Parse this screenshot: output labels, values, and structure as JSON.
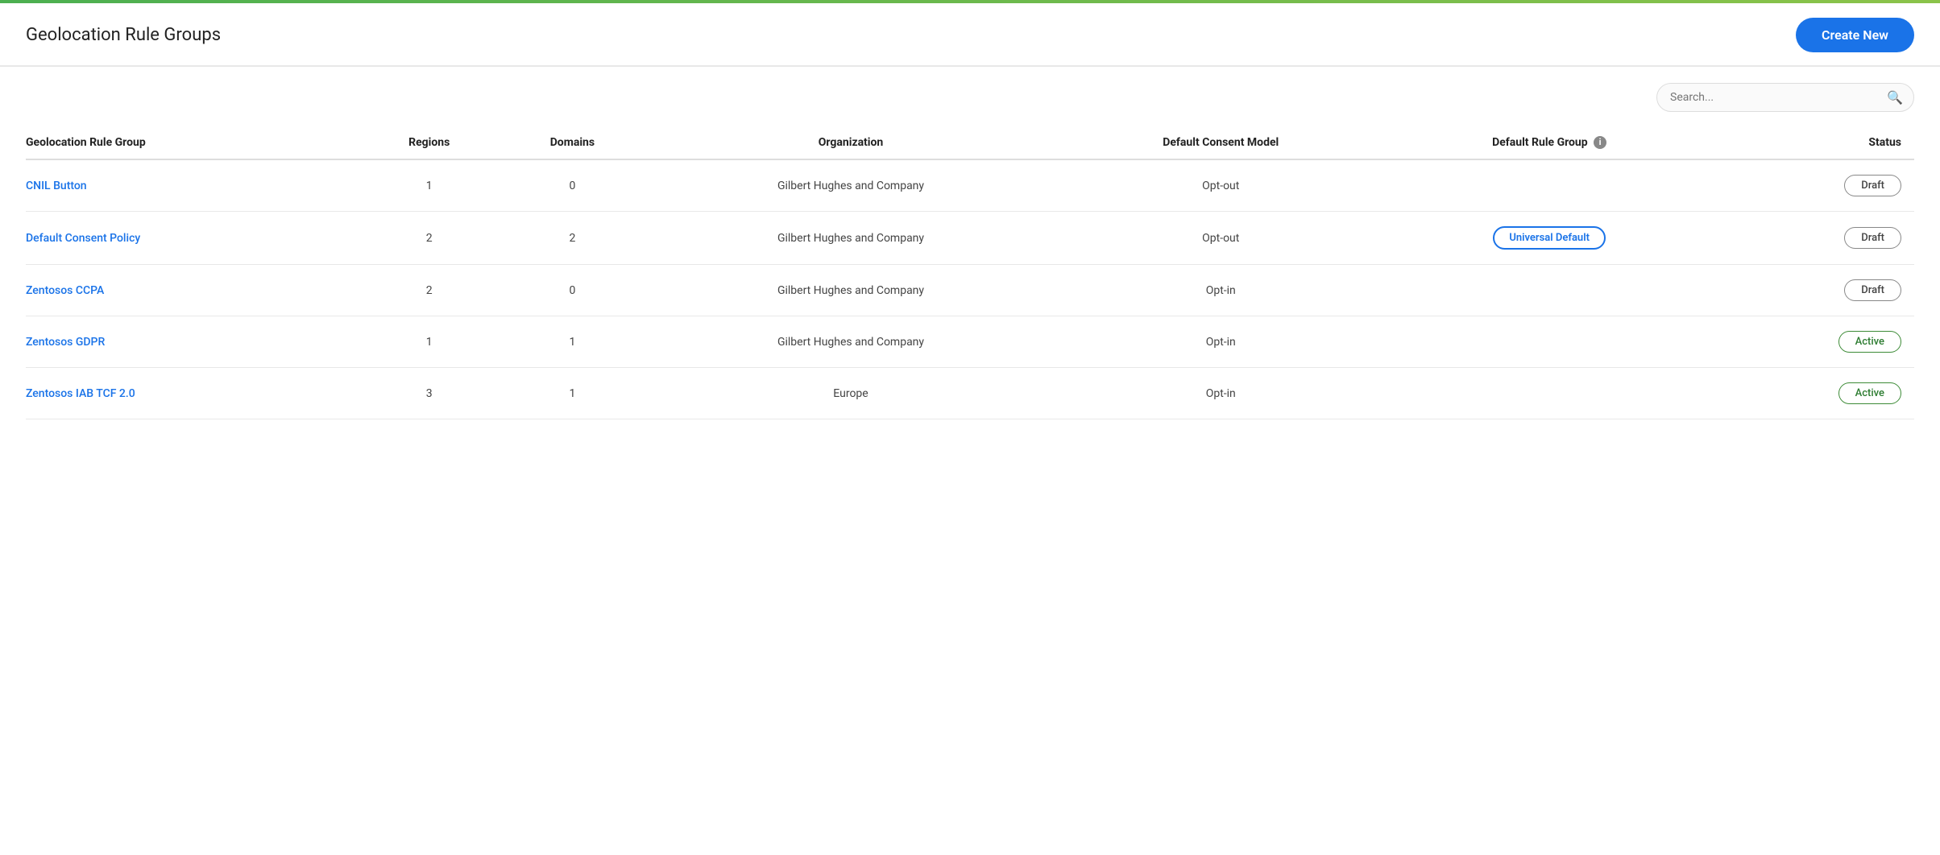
{
  "header": {
    "title": "Geolocation Rule Groups",
    "create_button_label": "Create New"
  },
  "search": {
    "placeholder": "Search..."
  },
  "table": {
    "columns": [
      {
        "key": "name",
        "label": "Geolocation Rule Group"
      },
      {
        "key": "regions",
        "label": "Regions"
      },
      {
        "key": "domains",
        "label": "Domains"
      },
      {
        "key": "organization",
        "label": "Organization"
      },
      {
        "key": "consent_model",
        "label": "Default Consent Model"
      },
      {
        "key": "default_rule_group",
        "label": "Default Rule Group",
        "has_info": true
      },
      {
        "key": "status",
        "label": "Status"
      }
    ],
    "rows": [
      {
        "name": "CNIL Button",
        "regions": "1",
        "domains": "0",
        "organization": "Gilbert Hughes and Company",
        "consent_model": "Opt-out",
        "default_rule_group": "",
        "status": "Draft",
        "status_type": "draft"
      },
      {
        "name": "Default Consent Policy",
        "regions": "2",
        "domains": "2",
        "organization": "Gilbert Hughes and Company",
        "consent_model": "Opt-out",
        "default_rule_group": "Universal Default",
        "status": "Draft",
        "status_type": "draft"
      },
      {
        "name": "Zentosos CCPA",
        "regions": "2",
        "domains": "0",
        "organization": "Gilbert Hughes and Company",
        "consent_model": "Opt-in",
        "default_rule_group": "",
        "status": "Draft",
        "status_type": "draft"
      },
      {
        "name": "Zentosos GDPR",
        "regions": "1",
        "domains": "1",
        "organization": "Gilbert Hughes and Company",
        "consent_model": "Opt-in",
        "default_rule_group": "",
        "status": "Active",
        "status_type": "active"
      },
      {
        "name": "Zentosos IAB TCF 2.0",
        "regions": "3",
        "domains": "1",
        "organization": "Europe",
        "consent_model": "Opt-in",
        "default_rule_group": "",
        "status": "Active",
        "status_type": "active"
      }
    ]
  },
  "colors": {
    "accent_blue": "#1a73e8",
    "active_green": "#2e7d32",
    "active_border": "#3d8b37",
    "draft_border": "#888"
  }
}
